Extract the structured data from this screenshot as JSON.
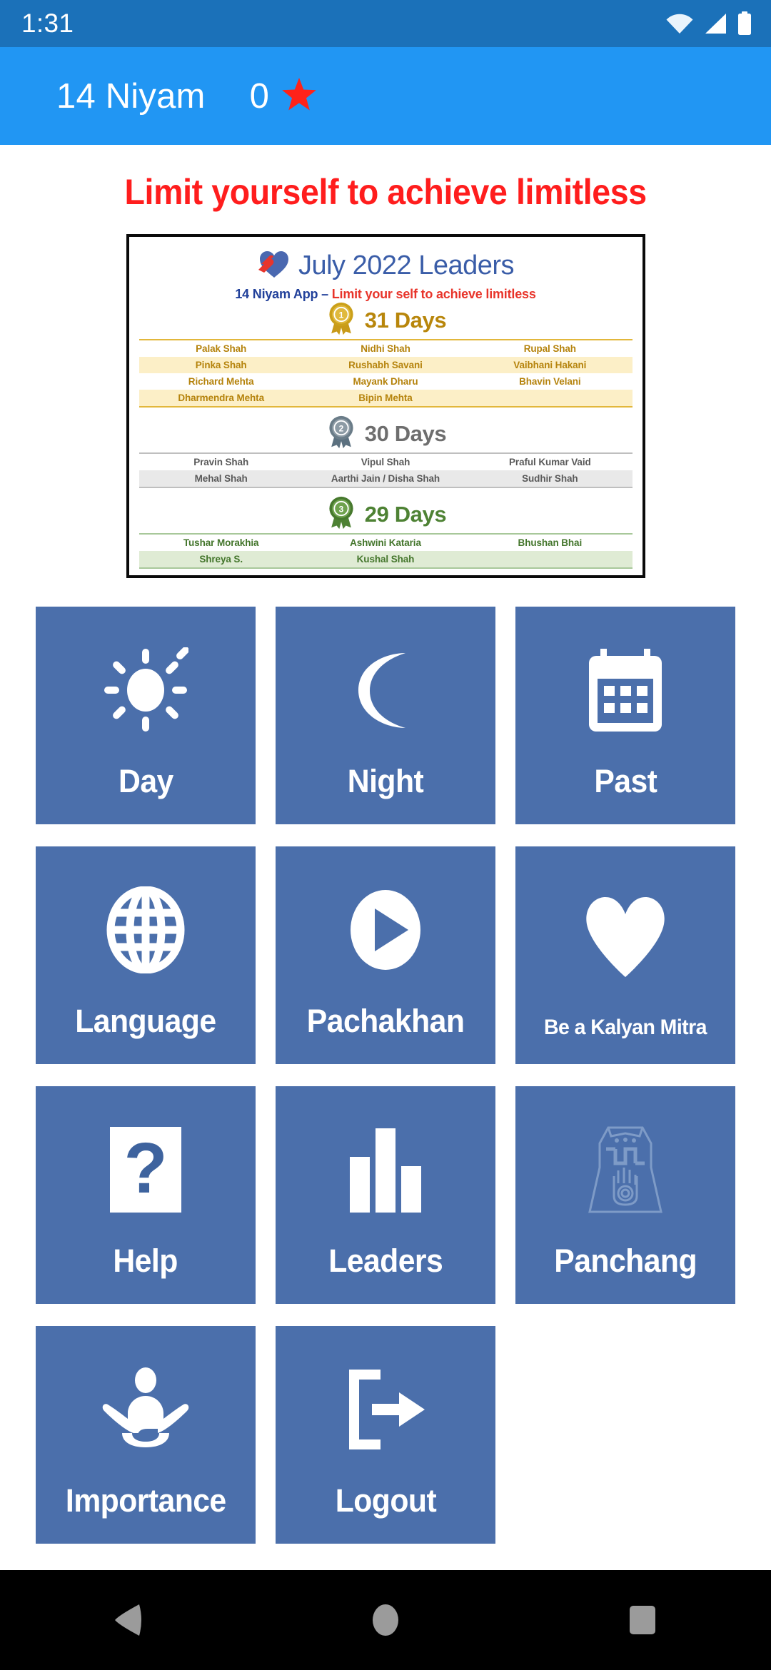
{
  "status_bar": {
    "clock": "1:31",
    "icons": [
      "wifi-icon",
      "cellular-signal-icon",
      "battery-icon"
    ]
  },
  "app_bar": {
    "title": "14 Niyam",
    "star_count": "0",
    "star_icon": "star-icon",
    "background_color": "#2196F3"
  },
  "tagline": "Limit yourself to achieve limitless",
  "poster": {
    "logo_icon": "heart-hands-icon",
    "title": "July 2022 Leaders",
    "subtitle_blue": "14 Niyam App – ",
    "subtitle_red": "Limit your self to achieve limitless",
    "ranks": [
      {
        "medal": "gold-medal-1-icon",
        "heading": "31 Days",
        "color": "#B8860B",
        "rows": [
          [
            "Palak Shah",
            "Nidhi Shah",
            "Rupal Shah"
          ],
          [
            "Pinka Shah",
            "Rushabh Savani",
            "Vaibhani Hakani"
          ],
          [
            "Richard Mehta",
            "Mayank Dharu",
            "Bhavin Velani"
          ],
          [
            "Dharmendra Mehta",
            "Bipin Mehta",
            ""
          ]
        ]
      },
      {
        "medal": "silver-medal-2-icon",
        "heading": "30 Days",
        "color": "#6E6E6E",
        "rows": [
          [
            "Pravin Shah",
            "Vipul Shah",
            "Praful Kumar Vaid"
          ],
          [
            "Mehal Shah",
            "Aarthi Jain / Disha Shah",
            "Sudhir Shah"
          ]
        ]
      },
      {
        "medal": "bronze-medal-3-icon",
        "heading": "29 Days",
        "color": "#4E8234",
        "rows": [
          [
            "Tushar Morakhia",
            "Ashwini Kataria",
            "Bhushan Bhai"
          ],
          [
            "Shreya S.",
            "Kushal Shah",
            ""
          ]
        ]
      }
    ]
  },
  "grid": {
    "tile_color": "#4B6FAB",
    "tiles": [
      {
        "label": "Day",
        "icon": "sun-icon"
      },
      {
        "label": "Night",
        "icon": "moon-icon"
      },
      {
        "label": "Past",
        "icon": "calendar-icon"
      },
      {
        "label": "Language",
        "icon": "globe-icon"
      },
      {
        "label": "Pachakhan",
        "icon": "play-circle-icon"
      },
      {
        "label": "Be a Kalyan Mitra",
        "icon": "heart-icon"
      },
      {
        "label": "Help",
        "icon": "question-mark-icon"
      },
      {
        "label": "Leaders",
        "icon": "bar-chart-icon"
      },
      {
        "label": "Panchang",
        "icon": "jain-ahimsa-hand-icon"
      },
      {
        "label": "Importance",
        "icon": "meditation-icon"
      },
      {
        "label": "Logout",
        "icon": "logout-arrow-icon"
      }
    ]
  },
  "nav_bar": {
    "back": "back-triangle-icon",
    "home": "home-circle-icon",
    "recents": "recents-square-icon"
  }
}
